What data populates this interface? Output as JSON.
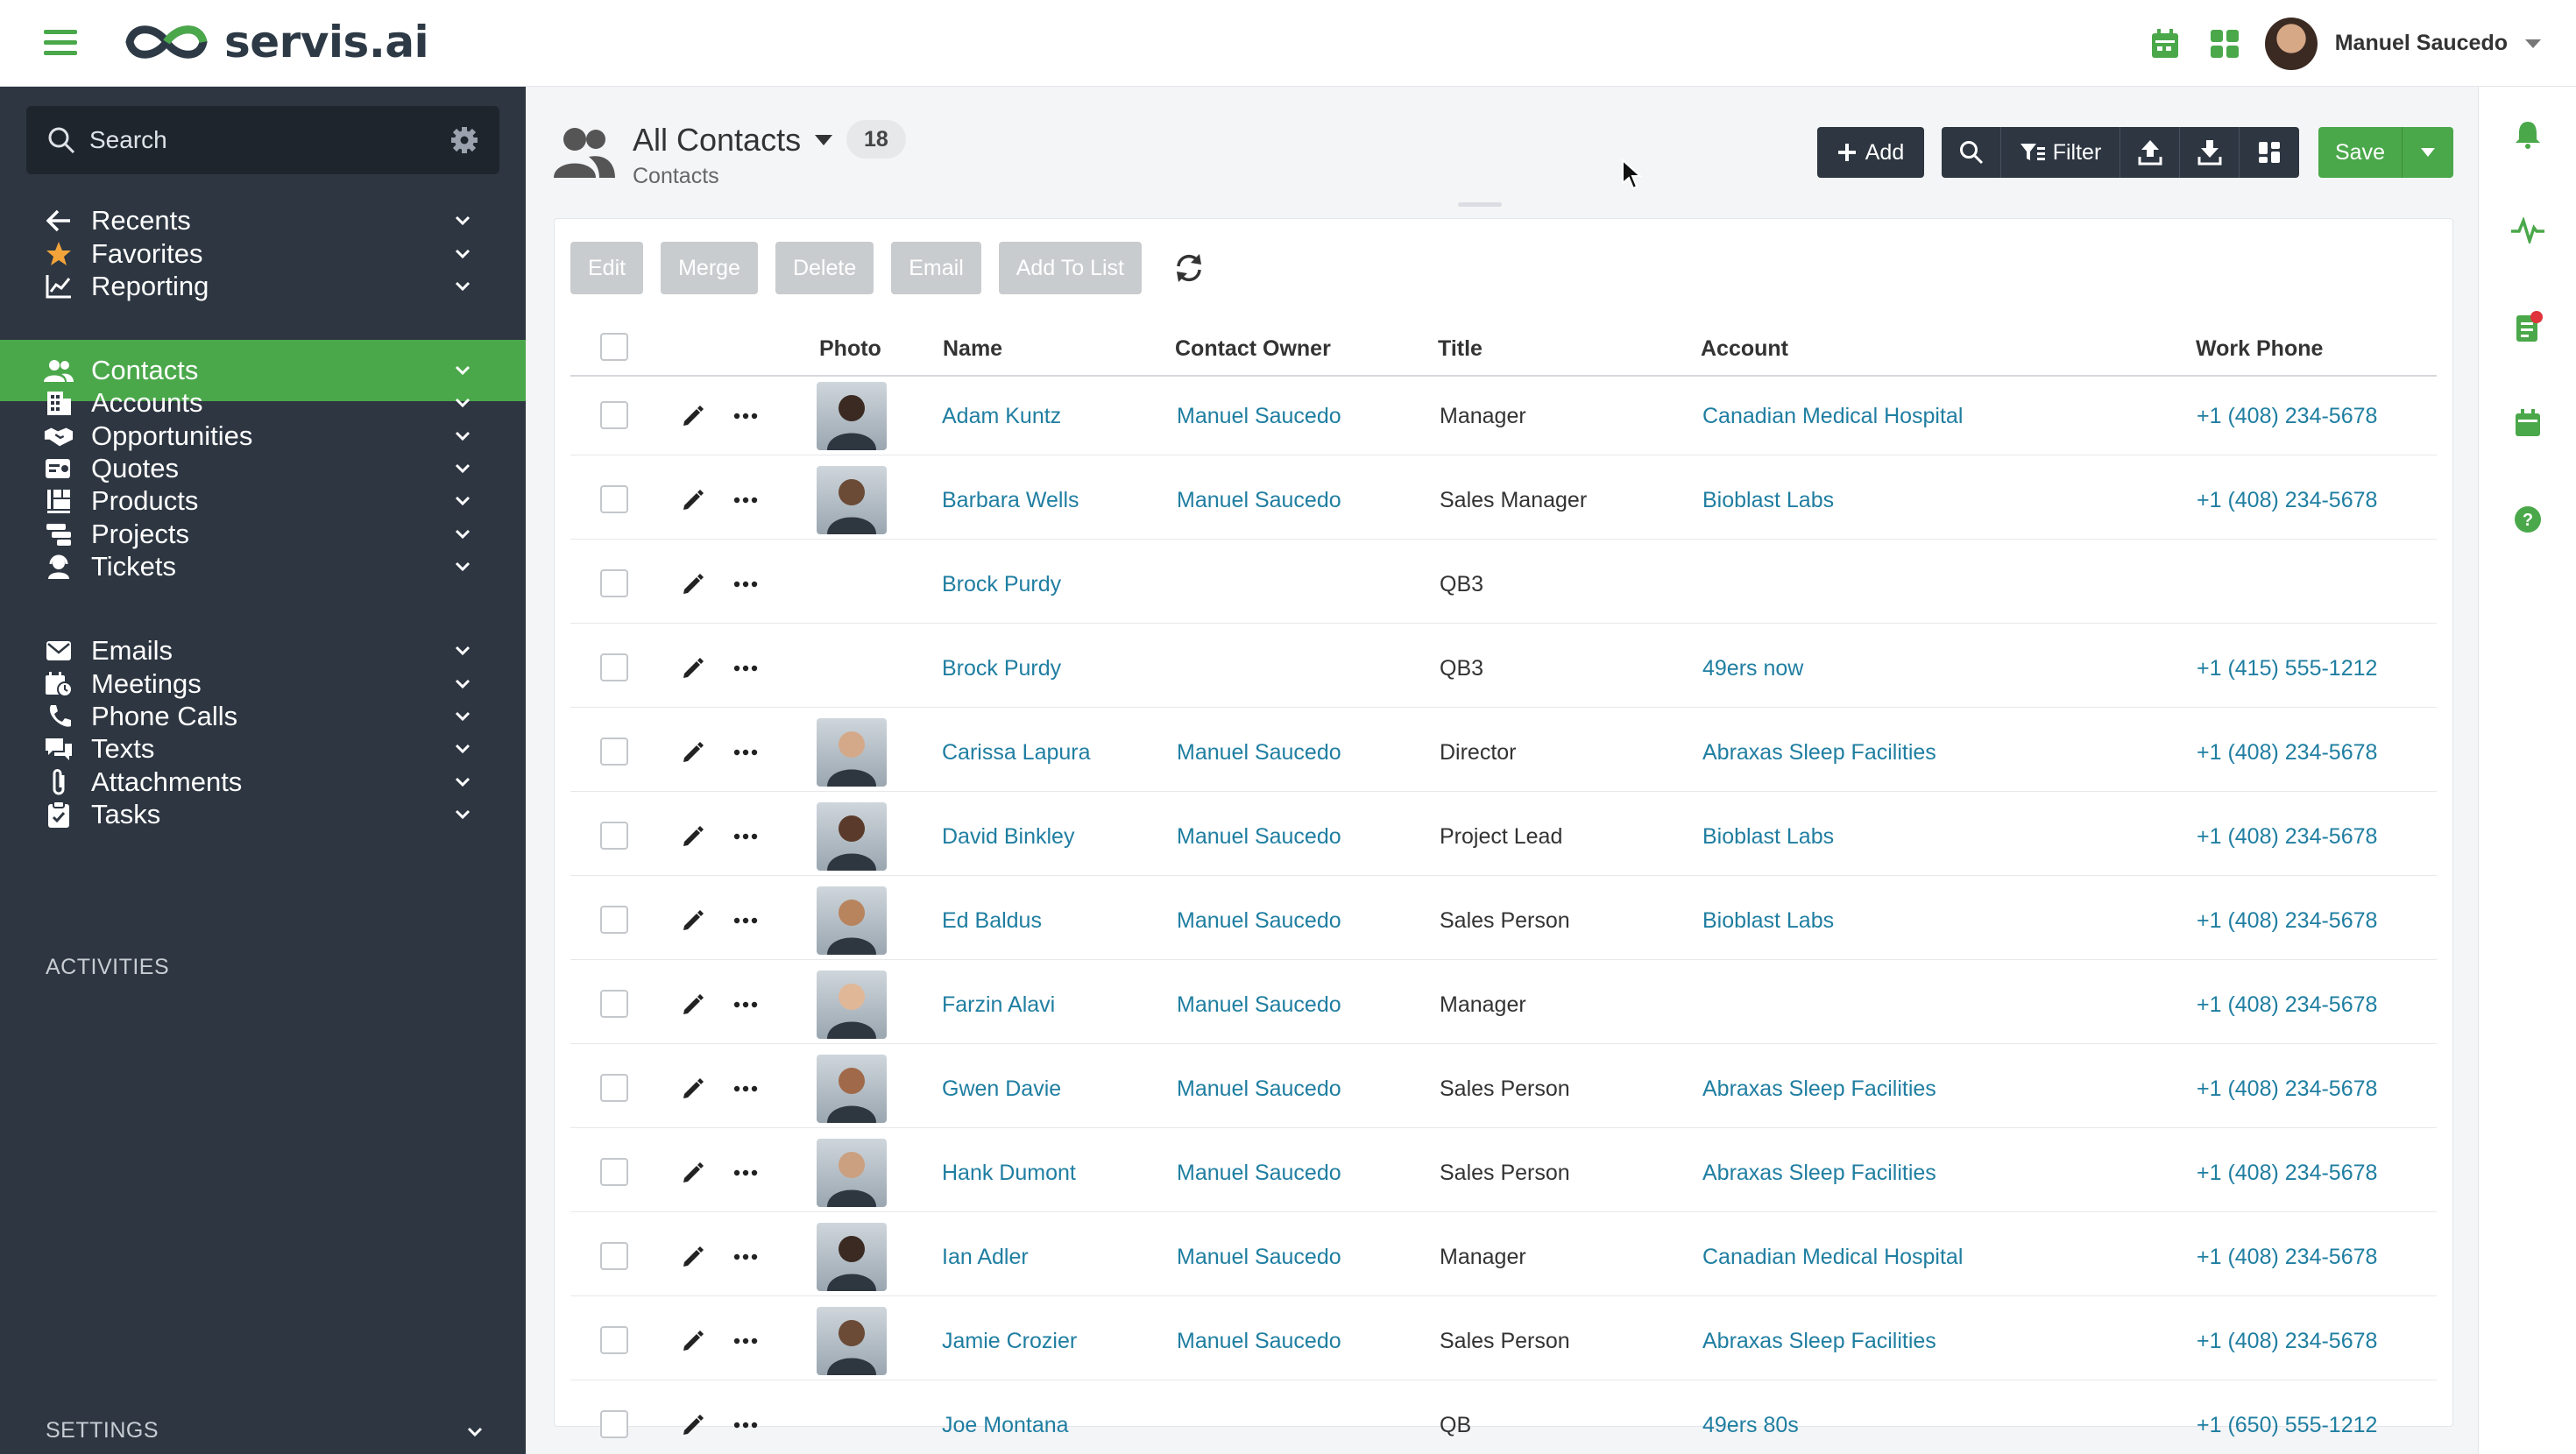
{
  "app": {
    "logo_text": "servis.ai",
    "brand_color": "#4aa84a",
    "dark_color": "#2d3641",
    "link_color": "#1f7ea1"
  },
  "topbar": {
    "user_name": "Manuel Saucedo",
    "icons": [
      "calendar-icon",
      "apps-grid-icon"
    ]
  },
  "sidebar": {
    "search_label": "Search",
    "items": [
      {
        "label": "Recents",
        "icon": "arrow-left-icon"
      },
      {
        "label": "Favorites",
        "icon": "star-icon"
      },
      {
        "label": "Reporting",
        "icon": "chart-line-icon"
      },
      {
        "label": "Contacts",
        "icon": "users-icon",
        "active": true
      },
      {
        "label": "Accounts",
        "icon": "building-icon"
      },
      {
        "label": "Opportunities",
        "icon": "handshake-icon"
      },
      {
        "label": "Quotes",
        "icon": "quote-icon"
      },
      {
        "label": "Products",
        "icon": "products-icon"
      },
      {
        "label": "Projects",
        "icon": "projects-icon"
      },
      {
        "label": "Tickets",
        "icon": "support-agent-icon"
      }
    ],
    "activities_label": "ACTIVITIES",
    "activities": [
      {
        "label": "Emails",
        "icon": "envelope-icon"
      },
      {
        "label": "Meetings",
        "icon": "calendar-clock-icon"
      },
      {
        "label": "Phone Calls",
        "icon": "phone-icon"
      },
      {
        "label": "Texts",
        "icon": "chat-icon"
      },
      {
        "label": "Attachments",
        "icon": "paperclip-icon"
      },
      {
        "label": "Tasks",
        "icon": "clipboard-icon"
      }
    ],
    "settings_label": "SETTINGS"
  },
  "page": {
    "title": "All Contacts",
    "count": "18",
    "subtitle": "Contacts",
    "toolbar": {
      "add_label": "Add",
      "filter_label": "Filter",
      "save_label": "Save"
    }
  },
  "bulk_actions": [
    "Edit",
    "Merge",
    "Delete",
    "Email",
    "Add To List"
  ],
  "table": {
    "columns": [
      "Photo",
      "Name",
      "Contact Owner",
      "Title",
      "Account",
      "Work Phone"
    ],
    "rows": [
      {
        "photo": true,
        "name": "Adam Kuntz",
        "owner": "Manuel Saucedo",
        "title": "Manager",
        "account": "Canadian Medical Hospital",
        "phone": "+1 (408) 234-5678"
      },
      {
        "photo": true,
        "name": "Barbara Wells",
        "owner": "Manuel Saucedo",
        "title": "Sales Manager",
        "account": "Bioblast Labs",
        "phone": "+1 (408) 234-5678"
      },
      {
        "photo": false,
        "name": "Brock Purdy",
        "owner": "",
        "title": "QB3",
        "account": "",
        "phone": ""
      },
      {
        "photo": false,
        "name": "Brock Purdy",
        "owner": "",
        "title": "QB3",
        "account": "49ers now",
        "phone": "+1 (415) 555-1212"
      },
      {
        "photo": true,
        "name": "Carissa Lapura",
        "owner": "Manuel Saucedo",
        "title": "Director",
        "account": "Abraxas Sleep Facilities",
        "phone": "+1 (408) 234-5678"
      },
      {
        "photo": true,
        "name": "David Binkley",
        "owner": "Manuel Saucedo",
        "title": "Project Lead",
        "account": "Bioblast Labs",
        "phone": "+1 (408) 234-5678"
      },
      {
        "photo": true,
        "name": "Ed Baldus",
        "owner": "Manuel Saucedo",
        "title": "Sales Person",
        "account": "Bioblast Labs",
        "phone": "+1 (408) 234-5678"
      },
      {
        "photo": true,
        "name": "Farzin Alavi",
        "owner": "Manuel Saucedo",
        "title": "Manager",
        "account": "",
        "phone": "+1 (408) 234-5678"
      },
      {
        "photo": true,
        "name": "Gwen Davie",
        "owner": "Manuel Saucedo",
        "title": "Sales Person",
        "account": "Abraxas Sleep Facilities",
        "phone": "+1 (408) 234-5678"
      },
      {
        "photo": true,
        "name": "Hank Dumont",
        "owner": "Manuel Saucedo",
        "title": "Sales Person",
        "account": "Abraxas Sleep Facilities",
        "phone": "+1 (408) 234-5678"
      },
      {
        "photo": true,
        "name": "Ian Adler",
        "owner": "Manuel Saucedo",
        "title": "Manager",
        "account": "Canadian Medical Hospital",
        "phone": "+1 (408) 234-5678"
      },
      {
        "photo": true,
        "name": "Jamie Crozier",
        "owner": "Manuel Saucedo",
        "title": "Sales Person",
        "account": "Abraxas Sleep Facilities",
        "phone": "+1 (408) 234-5678"
      },
      {
        "photo": false,
        "name": "Joe Montana",
        "owner": "",
        "title": "QB",
        "account": "49ers 80s",
        "phone": "+1 (650) 555-1212"
      }
    ]
  },
  "right_rail": [
    "bell-icon",
    "activity-pulse-icon",
    "notes-icon",
    "calendar-icon",
    "help-icon"
  ]
}
